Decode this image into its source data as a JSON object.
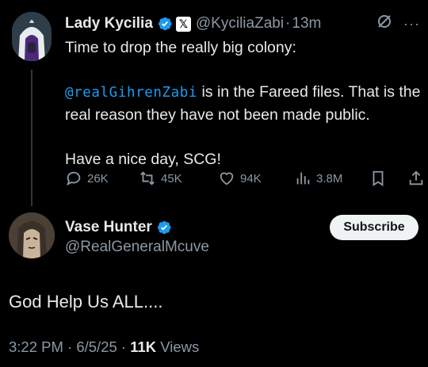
{
  "parent_tweet": {
    "display_name": "Lady Kycilia",
    "handle": "@KyciliaZabi",
    "separator": "·",
    "time": "13m",
    "x_badge": "𝕏",
    "more": "···",
    "line1": "Time to drop the really big colony:",
    "mention": "@realGihrenZabi",
    "line2_rest": " is in the Fareed  files. That is the real reason they have not been made public.",
    "line3": "Have a nice day, SCG!",
    "actions": {
      "replies": "26K",
      "reposts": "45K",
      "likes": "94K",
      "views": "3.8M"
    }
  },
  "reply": {
    "display_name": "Vase Hunter",
    "handle": "@RealGeneralMcuve",
    "subscribe_label": "Subscribe",
    "text": "God Help Us ALL....",
    "timestamp": "3:22 PM · 6/5/25 · ",
    "view_count": "11K",
    "views_label": " Views"
  },
  "colors": {
    "background": "#000000",
    "accent": "#1d9bf0",
    "secondary_text": "#8b98a5",
    "primary_text": "#e7e9ea"
  },
  "icons": [
    "verified-badge-icon",
    "x-logo-icon",
    "grok-icon",
    "reply-icon",
    "repost-icon",
    "like-icon",
    "views-icon",
    "bookmark-icon",
    "share-icon"
  ]
}
